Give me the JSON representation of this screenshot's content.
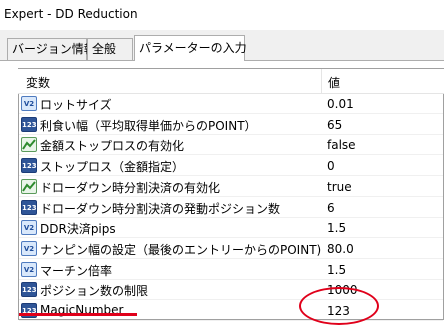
{
  "window": {
    "title": "Expert - DD Reduction"
  },
  "tabs": [
    {
      "label": "バージョン情報"
    },
    {
      "label": "全般"
    },
    {
      "label": "パラメーターの入力"
    }
  ],
  "grid": {
    "header_name": "変数",
    "header_value": "値",
    "rows": [
      {
        "icon": "fraction-icon",
        "label": "ロットサイズ",
        "value": "0.01"
      },
      {
        "icon": "integer-icon",
        "label": "利食い幅（平均取得単価からのPOINT）",
        "value": "65"
      },
      {
        "icon": "boolean-icon",
        "label": "金額ストップロスの有効化",
        "value": "false"
      },
      {
        "icon": "integer-icon",
        "label": "ストップロス（金額指定）",
        "value": "0"
      },
      {
        "icon": "boolean-icon",
        "label": "ドローダウン時分割決済の有効化",
        "value": "true"
      },
      {
        "icon": "integer-icon",
        "label": "ドローダウン時分割決済の発動ポジション数",
        "value": "6"
      },
      {
        "icon": "fraction-icon",
        "label": "DDR決済pips",
        "value": "1.5"
      },
      {
        "icon": "fraction-icon",
        "label": "ナンピン幅の設定（最後のエントリーからのPOINT)",
        "value": "80.0"
      },
      {
        "icon": "fraction-icon",
        "label": "マーチン倍率",
        "value": "1.5"
      },
      {
        "icon": "integer-icon",
        "label": "ポジション数の制限",
        "value": "1000"
      },
      {
        "icon": "integer-icon",
        "label": "MagicNumber",
        "value": "123"
      }
    ]
  },
  "icon_text": {
    "fraction": "V2",
    "integer": "123"
  },
  "colors": {
    "annotation": "#e0001a",
    "integer_icon": "#2f5597",
    "fraction_icon": "#d9e8fb"
  }
}
